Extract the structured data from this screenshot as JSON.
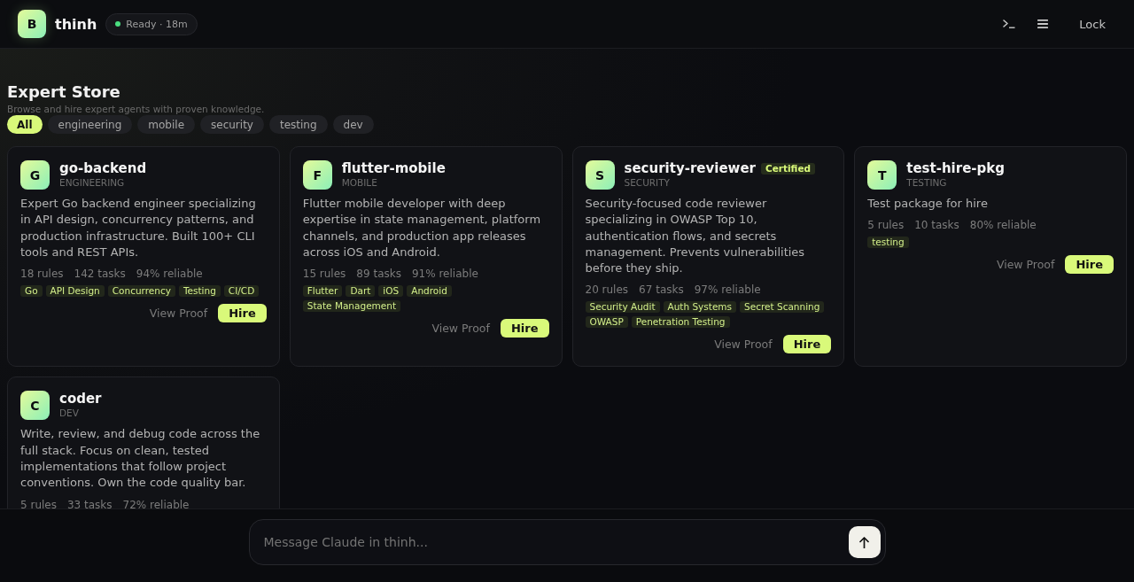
{
  "header": {
    "avatar": "B",
    "workspace": "thinh",
    "status": {
      "label": "Ready · 18m",
      "ready": true
    },
    "lock_button": "Lock"
  },
  "store": {
    "title": "Expert Store",
    "subtitle": "Browse and hire expert agents with proven knowledge."
  },
  "filters": [
    {
      "label": "All",
      "selected": true
    },
    {
      "label": "engineering",
      "selected": false
    },
    {
      "label": "mobile",
      "selected": false
    },
    {
      "label": "security",
      "selected": false
    },
    {
      "label": "testing",
      "selected": false
    },
    {
      "label": "dev",
      "selected": false
    }
  ],
  "experts": [
    {
      "initial": "G",
      "name": "go-backend",
      "category": "ENGINEERING",
      "description": "Expert Go backend engineer specializing in API design, concurrency patterns, and production infrastructure. Built 100+ CLI tools and REST APIs.",
      "stats": [
        "18 rules",
        "142 tasks",
        "94% reliable"
      ],
      "tags": [
        "Go",
        "API Design",
        "Concurrency",
        "Testing",
        "CI/CD"
      ],
      "actions": [
        {
          "kind": "link",
          "label": "View Proof"
        },
        {
          "kind": "primary",
          "label": "Hire"
        }
      ]
    },
    {
      "initial": "F",
      "name": "flutter-mobile",
      "category": "MOBILE",
      "description": "Flutter mobile developer with deep expertise in state management, platform channels, and production app releases across iOS and Android.",
      "stats": [
        "15 rules",
        "89 tasks",
        "91% reliable"
      ],
      "tags": [
        "Flutter",
        "Dart",
        "iOS",
        "Android",
        "State Management"
      ],
      "actions": [
        {
          "kind": "link",
          "label": "View Proof"
        },
        {
          "kind": "primary",
          "label": "Hire"
        }
      ]
    },
    {
      "initial": "S",
      "name": "security-reviewer",
      "badge": "Certified",
      "category": "SECURITY",
      "description": "Security-focused code reviewer specializing in OWASP Top 10, authentication flows, and secrets management. Prevents vulnerabilities before they ship.",
      "stats": [
        "20 rules",
        "67 tasks",
        "97% reliable"
      ],
      "tags": [
        "Security Audit",
        "Auth Systems",
        "Secret Scanning",
        "OWASP",
        "Penetration Testing"
      ],
      "actions": [
        {
          "kind": "link",
          "label": "View Proof"
        },
        {
          "kind": "primary",
          "label": "Hire"
        }
      ]
    },
    {
      "initial": "T",
      "name": "test-hire-pkg",
      "category": "TESTING",
      "description": "Test package for hire",
      "stats": [
        "5 rules",
        "10 tasks",
        "80% reliable"
      ],
      "tags": [
        "testing"
      ],
      "actions": [
        {
          "kind": "link",
          "label": "View Proof"
        },
        {
          "kind": "primary",
          "label": "Hire"
        }
      ]
    },
    {
      "initial": "C",
      "name": "coder",
      "category": "DEV",
      "description": "Write, review, and debug code across the full stack. Focus on clean, tested implementations that follow project conventions. Own the code quality bar.",
      "stats": [
        "5 rules",
        "33 tasks",
        "72% reliable"
      ]
    }
  ],
  "composer": {
    "placeholder": "Message Claude in thinh..."
  }
}
